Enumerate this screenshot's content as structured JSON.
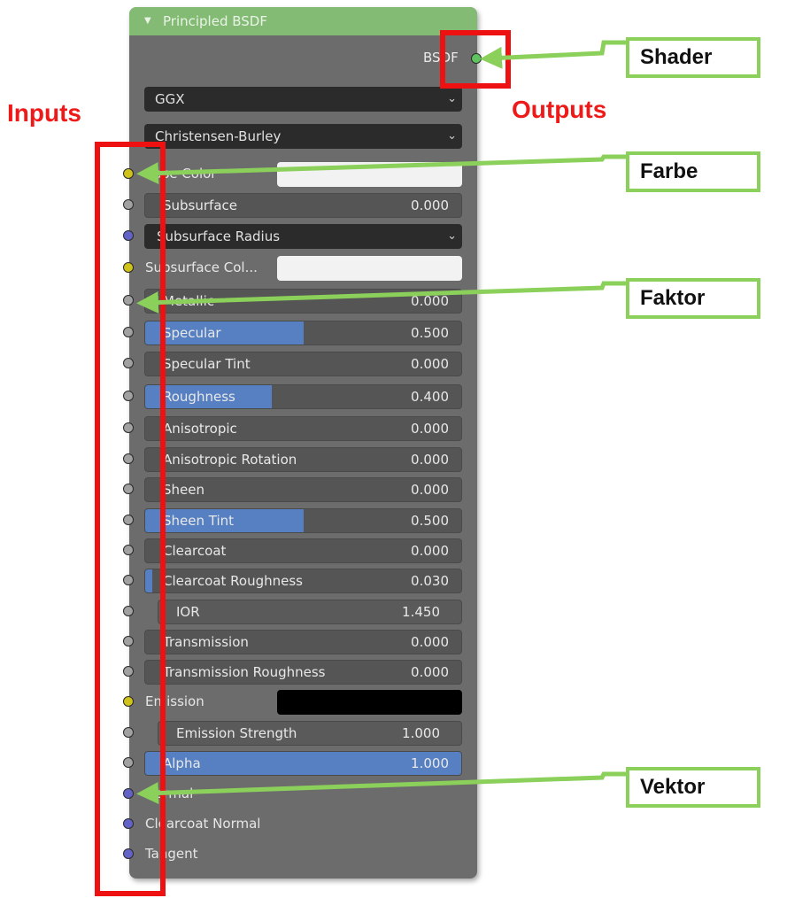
{
  "node": {
    "title": "Principled BSDF",
    "output_label": "BSDF",
    "distribution": "GGX",
    "subsurface_method": "Christensen-Burley",
    "dropdown_icon": "chevron-down-icon",
    "collapse_icon": "triangle-down-icon"
  },
  "rows": [
    {
      "label": "Base Color",
      "type": "color",
      "color": "#f2f2f2",
      "socket": "#cfc21a"
    },
    {
      "label": "Subsurface",
      "type": "value",
      "value": "0.000",
      "fill": 0.0,
      "socket": "#a1a1a1"
    },
    {
      "label": "Subsurface Radius",
      "type": "dropdown",
      "socket": "#6363c7"
    },
    {
      "label": "Subsurface Col...",
      "type": "color",
      "color": "#f2f2f2",
      "socket": "#cfc21a"
    },
    {
      "label": "Metallic",
      "type": "value",
      "value": "0.000",
      "fill": 0.0,
      "socket": "#a1a1a1"
    },
    {
      "label": "Specular",
      "type": "value",
      "value": "0.500",
      "fill": 0.5,
      "socket": "#a1a1a1"
    },
    {
      "label": "Specular Tint",
      "type": "value",
      "value": "0.000",
      "fill": 0.0,
      "socket": "#a1a1a1"
    },
    {
      "label": "Roughness",
      "type": "value",
      "value": "0.400",
      "fill": 0.4,
      "socket": "#a1a1a1"
    },
    {
      "label": "Anisotropic",
      "type": "value",
      "value": "0.000",
      "fill": 0.0,
      "socket": "#a1a1a1"
    },
    {
      "label": "Anisotropic Rotation",
      "type": "value",
      "value": "0.000",
      "fill": 0.0,
      "socket": "#a1a1a1"
    },
    {
      "label": "Sheen",
      "type": "value",
      "value": "0.000",
      "fill": 0.0,
      "socket": "#a1a1a1"
    },
    {
      "label": "Sheen Tint",
      "type": "value",
      "value": "0.500",
      "fill": 0.5,
      "socket": "#a1a1a1"
    },
    {
      "label": "Clearcoat",
      "type": "value",
      "value": "0.000",
      "fill": 0.0,
      "socket": "#a1a1a1"
    },
    {
      "label": "Clearcoat Roughness",
      "type": "value",
      "value": "0.030",
      "fill": 0.03,
      "socket": "#a1a1a1"
    },
    {
      "label": "IOR",
      "type": "value-noslider",
      "value": "1.450",
      "socket": "#a1a1a1"
    },
    {
      "label": "Transmission",
      "type": "value",
      "value": "0.000",
      "fill": 0.0,
      "socket": "#a1a1a1"
    },
    {
      "label": "Transmission Roughness",
      "type": "value",
      "value": "0.000",
      "fill": 0.0,
      "socket": "#a1a1a1"
    },
    {
      "label": "Emission",
      "type": "color",
      "color": "#000000",
      "socket": "#cfc21a"
    },
    {
      "label": "Emission Strength",
      "type": "value-noslider",
      "value": "1.000",
      "socket": "#a1a1a1"
    },
    {
      "label": "Alpha",
      "type": "value",
      "value": "1.000",
      "fill": 1.0,
      "socket": "#a1a1a1"
    },
    {
      "label": "Normal",
      "type": "socket-only",
      "socket": "#6363c7"
    },
    {
      "label": "Clearcoat Normal",
      "type": "socket-only",
      "socket": "#6363c7"
    },
    {
      "label": "Tangent",
      "type": "socket-only",
      "socket": "#6363c7"
    }
  ],
  "annotations": {
    "inputs_label": "Inputs",
    "outputs_label": "Outputs",
    "shader_label": "Shader",
    "farbe_label": "Farbe",
    "faktor_label": "Faktor",
    "vektor_label": "Vektor",
    "red_color": "#ee1111",
    "green_color": "#8bd05a"
  },
  "colors": {
    "node_bg": "#6c6c6c",
    "header": "#83bb74",
    "slider_fill": "#5680c2",
    "output_socket": "#5fc45f"
  }
}
